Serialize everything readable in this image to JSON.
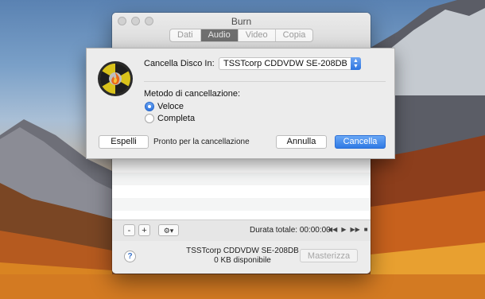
{
  "window": {
    "title": "Burn",
    "tabs": [
      {
        "label": "Dati",
        "active": false
      },
      {
        "label": "Audio",
        "active": true
      },
      {
        "label": "Video",
        "active": false
      },
      {
        "label": "Copia",
        "active": false
      }
    ]
  },
  "toolbar": {
    "remove_label": "-",
    "add_label": "+",
    "actions_label": "⚙▾",
    "duration": "Durata totale: 00:00:00",
    "transport": [
      "◀◀",
      "▶",
      "▶▶",
      "■"
    ]
  },
  "status": {
    "help_label": "?",
    "device_name": "TSSTcorp CDDVDW SE-208DB",
    "free_space": "0 KB disponibile",
    "burn_button": "Masterizza"
  },
  "sheet": {
    "erase_disc_label": "Cancella Disco In:",
    "drive_selected": "TSSTcorp CDDVDW SE-208DB",
    "method_label": "Metodo di cancellazione:",
    "methods": [
      {
        "label": "Veloce",
        "selected": true
      },
      {
        "label": "Completa",
        "selected": false
      }
    ],
    "eject_button": "Espelli",
    "status_text": "Pronto per la cancellazione",
    "cancel_button": "Annulla",
    "erase_button": "Cancella"
  },
  "colors": {
    "accent": "#2f79e4",
    "active_tab": "#6f6f6f",
    "help_icon": "#3a73c9"
  }
}
